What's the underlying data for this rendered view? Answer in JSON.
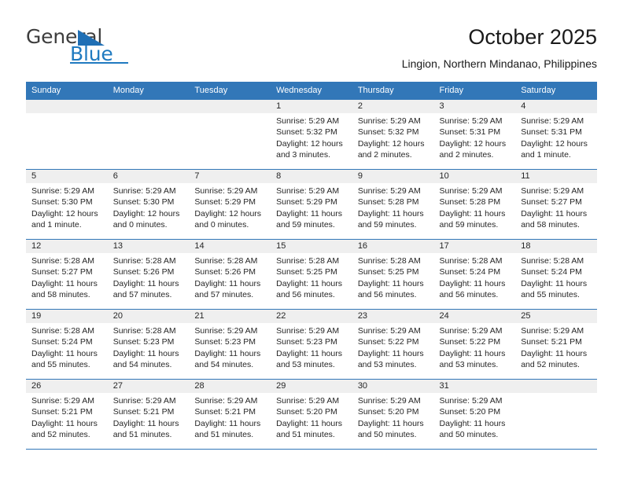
{
  "brand": {
    "name_part1": "General",
    "name_part2": "Blue",
    "accent_color": "#1f7ac0"
  },
  "header": {
    "title": "October 2025",
    "subtitle": "Lingion, Northern Mindanao, Philippines"
  },
  "theme": {
    "header_row_color": "#3277b8",
    "daynum_band_color": "#efefef",
    "text_color": "#262626"
  },
  "weekdays": [
    "Sunday",
    "Monday",
    "Tuesday",
    "Wednesday",
    "Thursday",
    "Friday",
    "Saturday"
  ],
  "weeks": [
    [
      {
        "day": "",
        "empty": true
      },
      {
        "day": "",
        "empty": true
      },
      {
        "day": "",
        "empty": true
      },
      {
        "day": "1",
        "sunrise": "Sunrise: 5:29 AM",
        "sunset": "Sunset: 5:32 PM",
        "daylight_l1": "Daylight: 12 hours",
        "daylight_l2": "and 3 minutes."
      },
      {
        "day": "2",
        "sunrise": "Sunrise: 5:29 AM",
        "sunset": "Sunset: 5:32 PM",
        "daylight_l1": "Daylight: 12 hours",
        "daylight_l2": "and 2 minutes."
      },
      {
        "day": "3",
        "sunrise": "Sunrise: 5:29 AM",
        "sunset": "Sunset: 5:31 PM",
        "daylight_l1": "Daylight: 12 hours",
        "daylight_l2": "and 2 minutes."
      },
      {
        "day": "4",
        "sunrise": "Sunrise: 5:29 AM",
        "sunset": "Sunset: 5:31 PM",
        "daylight_l1": "Daylight: 12 hours",
        "daylight_l2": "and 1 minute."
      }
    ],
    [
      {
        "day": "5",
        "sunrise": "Sunrise: 5:29 AM",
        "sunset": "Sunset: 5:30 PM",
        "daylight_l1": "Daylight: 12 hours",
        "daylight_l2": "and 1 minute."
      },
      {
        "day": "6",
        "sunrise": "Sunrise: 5:29 AM",
        "sunset": "Sunset: 5:30 PM",
        "daylight_l1": "Daylight: 12 hours",
        "daylight_l2": "and 0 minutes."
      },
      {
        "day": "7",
        "sunrise": "Sunrise: 5:29 AM",
        "sunset": "Sunset: 5:29 PM",
        "daylight_l1": "Daylight: 12 hours",
        "daylight_l2": "and 0 minutes."
      },
      {
        "day": "8",
        "sunrise": "Sunrise: 5:29 AM",
        "sunset": "Sunset: 5:29 PM",
        "daylight_l1": "Daylight: 11 hours",
        "daylight_l2": "and 59 minutes."
      },
      {
        "day": "9",
        "sunrise": "Sunrise: 5:29 AM",
        "sunset": "Sunset: 5:28 PM",
        "daylight_l1": "Daylight: 11 hours",
        "daylight_l2": "and 59 minutes."
      },
      {
        "day": "10",
        "sunrise": "Sunrise: 5:29 AM",
        "sunset": "Sunset: 5:28 PM",
        "daylight_l1": "Daylight: 11 hours",
        "daylight_l2": "and 59 minutes."
      },
      {
        "day": "11",
        "sunrise": "Sunrise: 5:29 AM",
        "sunset": "Sunset: 5:27 PM",
        "daylight_l1": "Daylight: 11 hours",
        "daylight_l2": "and 58 minutes."
      }
    ],
    [
      {
        "day": "12",
        "sunrise": "Sunrise: 5:28 AM",
        "sunset": "Sunset: 5:27 PM",
        "daylight_l1": "Daylight: 11 hours",
        "daylight_l2": "and 58 minutes."
      },
      {
        "day": "13",
        "sunrise": "Sunrise: 5:28 AM",
        "sunset": "Sunset: 5:26 PM",
        "daylight_l1": "Daylight: 11 hours",
        "daylight_l2": "and 57 minutes."
      },
      {
        "day": "14",
        "sunrise": "Sunrise: 5:28 AM",
        "sunset": "Sunset: 5:26 PM",
        "daylight_l1": "Daylight: 11 hours",
        "daylight_l2": "and 57 minutes."
      },
      {
        "day": "15",
        "sunrise": "Sunrise: 5:28 AM",
        "sunset": "Sunset: 5:25 PM",
        "daylight_l1": "Daylight: 11 hours",
        "daylight_l2": "and 56 minutes."
      },
      {
        "day": "16",
        "sunrise": "Sunrise: 5:28 AM",
        "sunset": "Sunset: 5:25 PM",
        "daylight_l1": "Daylight: 11 hours",
        "daylight_l2": "and 56 minutes."
      },
      {
        "day": "17",
        "sunrise": "Sunrise: 5:28 AM",
        "sunset": "Sunset: 5:24 PM",
        "daylight_l1": "Daylight: 11 hours",
        "daylight_l2": "and 56 minutes."
      },
      {
        "day": "18",
        "sunrise": "Sunrise: 5:28 AM",
        "sunset": "Sunset: 5:24 PM",
        "daylight_l1": "Daylight: 11 hours",
        "daylight_l2": "and 55 minutes."
      }
    ],
    [
      {
        "day": "19",
        "sunrise": "Sunrise: 5:28 AM",
        "sunset": "Sunset: 5:24 PM",
        "daylight_l1": "Daylight: 11 hours",
        "daylight_l2": "and 55 minutes."
      },
      {
        "day": "20",
        "sunrise": "Sunrise: 5:28 AM",
        "sunset": "Sunset: 5:23 PM",
        "daylight_l1": "Daylight: 11 hours",
        "daylight_l2": "and 54 minutes."
      },
      {
        "day": "21",
        "sunrise": "Sunrise: 5:29 AM",
        "sunset": "Sunset: 5:23 PM",
        "daylight_l1": "Daylight: 11 hours",
        "daylight_l2": "and 54 minutes."
      },
      {
        "day": "22",
        "sunrise": "Sunrise: 5:29 AM",
        "sunset": "Sunset: 5:23 PM",
        "daylight_l1": "Daylight: 11 hours",
        "daylight_l2": "and 53 minutes."
      },
      {
        "day": "23",
        "sunrise": "Sunrise: 5:29 AM",
        "sunset": "Sunset: 5:22 PM",
        "daylight_l1": "Daylight: 11 hours",
        "daylight_l2": "and 53 minutes."
      },
      {
        "day": "24",
        "sunrise": "Sunrise: 5:29 AM",
        "sunset": "Sunset: 5:22 PM",
        "daylight_l1": "Daylight: 11 hours",
        "daylight_l2": "and 53 minutes."
      },
      {
        "day": "25",
        "sunrise": "Sunrise: 5:29 AM",
        "sunset": "Sunset: 5:21 PM",
        "daylight_l1": "Daylight: 11 hours",
        "daylight_l2": "and 52 minutes."
      }
    ],
    [
      {
        "day": "26",
        "sunrise": "Sunrise: 5:29 AM",
        "sunset": "Sunset: 5:21 PM",
        "daylight_l1": "Daylight: 11 hours",
        "daylight_l2": "and 52 minutes."
      },
      {
        "day": "27",
        "sunrise": "Sunrise: 5:29 AM",
        "sunset": "Sunset: 5:21 PM",
        "daylight_l1": "Daylight: 11 hours",
        "daylight_l2": "and 51 minutes."
      },
      {
        "day": "28",
        "sunrise": "Sunrise: 5:29 AM",
        "sunset": "Sunset: 5:21 PM",
        "daylight_l1": "Daylight: 11 hours",
        "daylight_l2": "and 51 minutes."
      },
      {
        "day": "29",
        "sunrise": "Sunrise: 5:29 AM",
        "sunset": "Sunset: 5:20 PM",
        "daylight_l1": "Daylight: 11 hours",
        "daylight_l2": "and 51 minutes."
      },
      {
        "day": "30",
        "sunrise": "Sunrise: 5:29 AM",
        "sunset": "Sunset: 5:20 PM",
        "daylight_l1": "Daylight: 11 hours",
        "daylight_l2": "and 50 minutes."
      },
      {
        "day": "31",
        "sunrise": "Sunrise: 5:29 AM",
        "sunset": "Sunset: 5:20 PM",
        "daylight_l1": "Daylight: 11 hours",
        "daylight_l2": "and 50 minutes."
      },
      {
        "day": "",
        "empty": true
      }
    ]
  ]
}
